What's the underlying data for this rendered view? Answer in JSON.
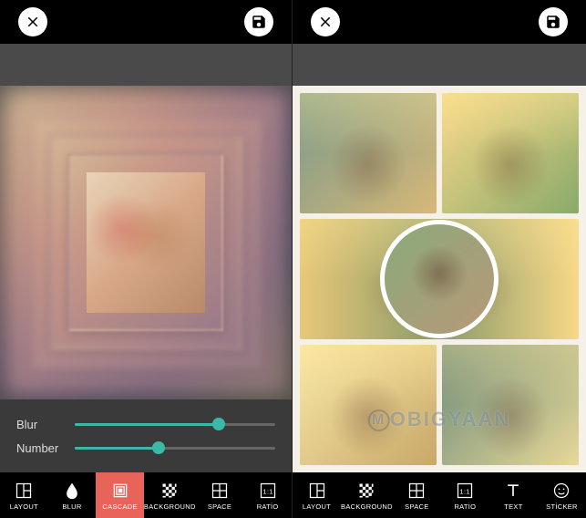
{
  "left": {
    "sliders": {
      "blur": {
        "label": "Blur",
        "value": 72
      },
      "number": {
        "label": "Number",
        "value": 42
      }
    },
    "toolbar": [
      {
        "id": "layout",
        "label": "LAYOUT",
        "active": false
      },
      {
        "id": "blur",
        "label": "BLUR",
        "active": false
      },
      {
        "id": "cascade",
        "label": "CASCADE",
        "active": true
      },
      {
        "id": "background",
        "label": "BACKGROUND",
        "active": false
      },
      {
        "id": "space",
        "label": "SPACE",
        "active": false
      },
      {
        "id": "ratio",
        "label": "RATİO",
        "active": false
      }
    ]
  },
  "right": {
    "watermark": "MOBIGYAAN",
    "toolbar": [
      {
        "id": "layout",
        "label": "LAYOUT"
      },
      {
        "id": "background",
        "label": "BACKGROUND"
      },
      {
        "id": "space",
        "label": "SPACE"
      },
      {
        "id": "ratio",
        "label": "RATİO"
      },
      {
        "id": "text",
        "label": "TEXT"
      },
      {
        "id": "sticker",
        "label": "STİCKER"
      }
    ]
  }
}
